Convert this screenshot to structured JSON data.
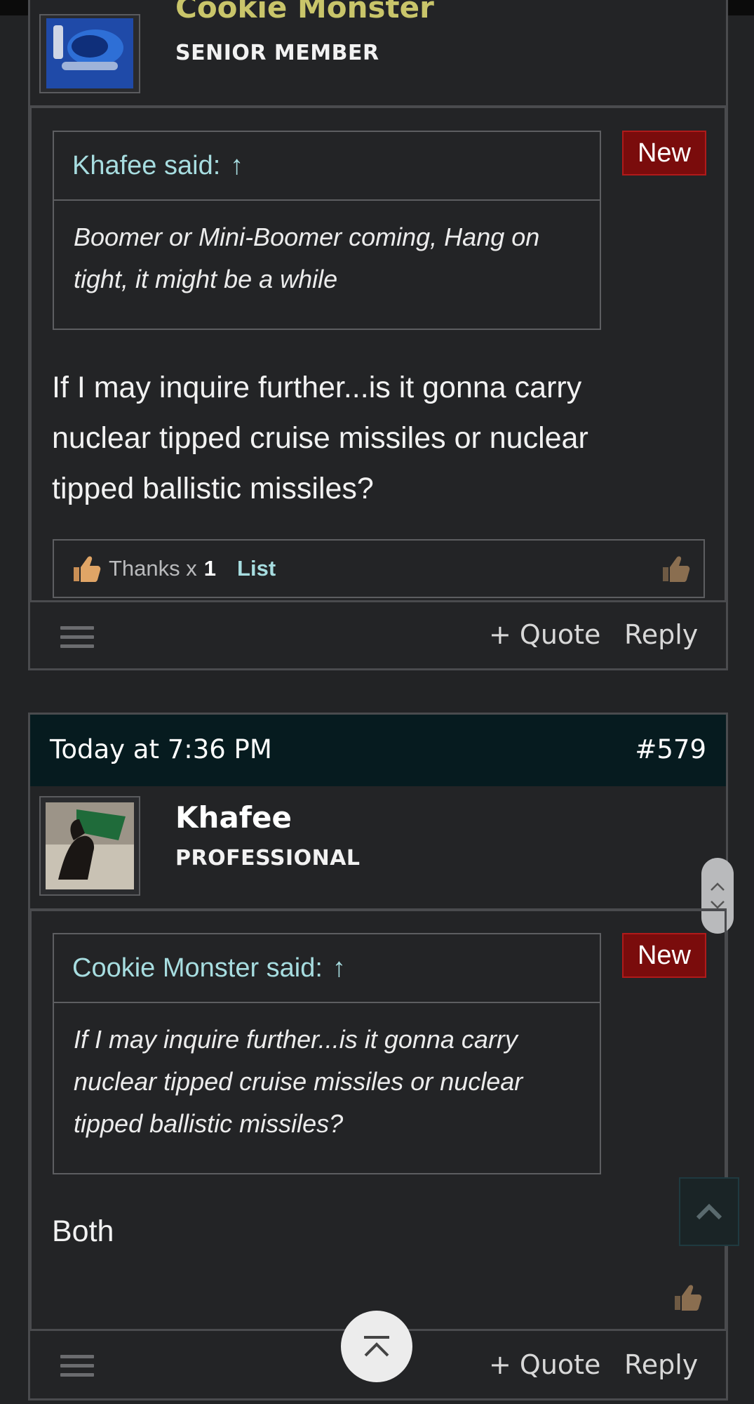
{
  "post1": {
    "username": "Cookie Monster",
    "user_title": "SENIOR MEMBER",
    "badge": "New",
    "quote": {
      "author_line": "Khafee said:",
      "arrow": "↑",
      "text": "Boomer or Mini-Boomer coming, Hang on tight, it might be a while"
    },
    "message": "If I may inquire further...is it gonna carry nuclear tipped cruise missiles or nuclear tipped ballistic missiles?",
    "reactions": {
      "thanks_label": "Thanks x",
      "thanks_count": "1",
      "list_label": "List"
    },
    "footer": {
      "quote_label": "+ Quote",
      "reply_label": "Reply"
    }
  },
  "post2": {
    "timestamp": "Today at 7:36 PM",
    "post_number": "#579",
    "username": "Khafee",
    "user_title": "PROFESSIONAL",
    "badge": "New",
    "quote": {
      "author_line": "Cookie Monster said:",
      "arrow": "↑",
      "text": "If I may inquire further...is it gonna carry nuclear tipped cruise missiles or nuclear tipped ballistic missiles?"
    },
    "message": "Both",
    "footer": {
      "quote_label": "+ Quote",
      "reply_label": "Reply"
    }
  },
  "colors": {
    "background": "#222325",
    "header_bar": "#061b1f",
    "quote_author": "#a7dde0",
    "list_link": "#a7dde0",
    "username_post1": "#c9c56a",
    "new_badge": "#7a0c0c"
  },
  "icons": [
    "menu-icon",
    "thumbs-up-icon",
    "scroll-up-arrow-icon",
    "scroll-down-arrow-icon",
    "back-to-top-icon",
    "chevron-up-icon",
    "avatar-image"
  ]
}
